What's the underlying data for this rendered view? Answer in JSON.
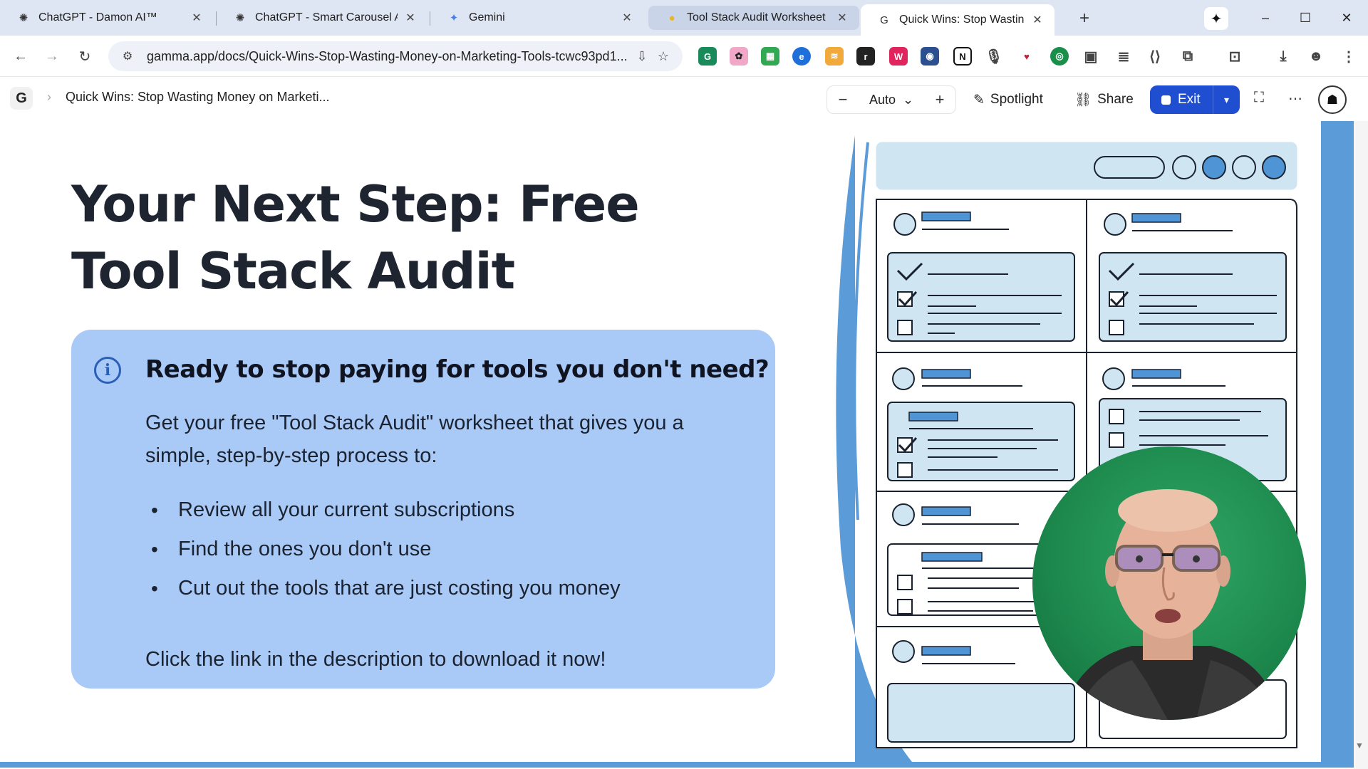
{
  "browser": {
    "tabs": [
      {
        "title": "ChatGPT - Damon AI™",
        "icon": "openai-icon"
      },
      {
        "title": "ChatGPT - Smart Carousel Ads",
        "icon": "openai-icon"
      },
      {
        "title": "Gemini",
        "icon": "gemini-icon"
      },
      {
        "title": "Tool Stack Audit Worksheet",
        "icon": "doc-icon",
        "state": "hover"
      },
      {
        "title": "Quick Wins: Stop Wasting Mon",
        "icon": "gamma-icon",
        "state": "active"
      }
    ],
    "url": "gamma.app/docs/Quick-Wins-Stop-Wasting-Money-on-Marketing-Tools-tcwc93pd1..."
  },
  "toolbar": {
    "doc_title": "Quick Wins: Stop Wasting Money on Marketi...",
    "zoom_label": "Auto",
    "spotlight_label": "Spotlight",
    "share_label": "Share",
    "exit_label": "Exit"
  },
  "slide": {
    "title": "Your Next Step: Free Tool Stack Audit",
    "callout": {
      "heading": "Ready to stop paying for tools you don't need?",
      "intro": "Get your free \"Tool Stack Audit\" worksheet that gives you a simple, step-by-step process to:",
      "bullets": [
        "Review all your current subscriptions",
        "Find the ones you don't use",
        "Cut out the tools that are just costing you money"
      ],
      "cta": "Click the link in the description to download it now!"
    }
  },
  "colors": {
    "callout_bg": "#a9c9f7",
    "accent_blue": "#5b9bd8",
    "exit_button": "#1f4fd0",
    "title_text": "#1f2530"
  }
}
